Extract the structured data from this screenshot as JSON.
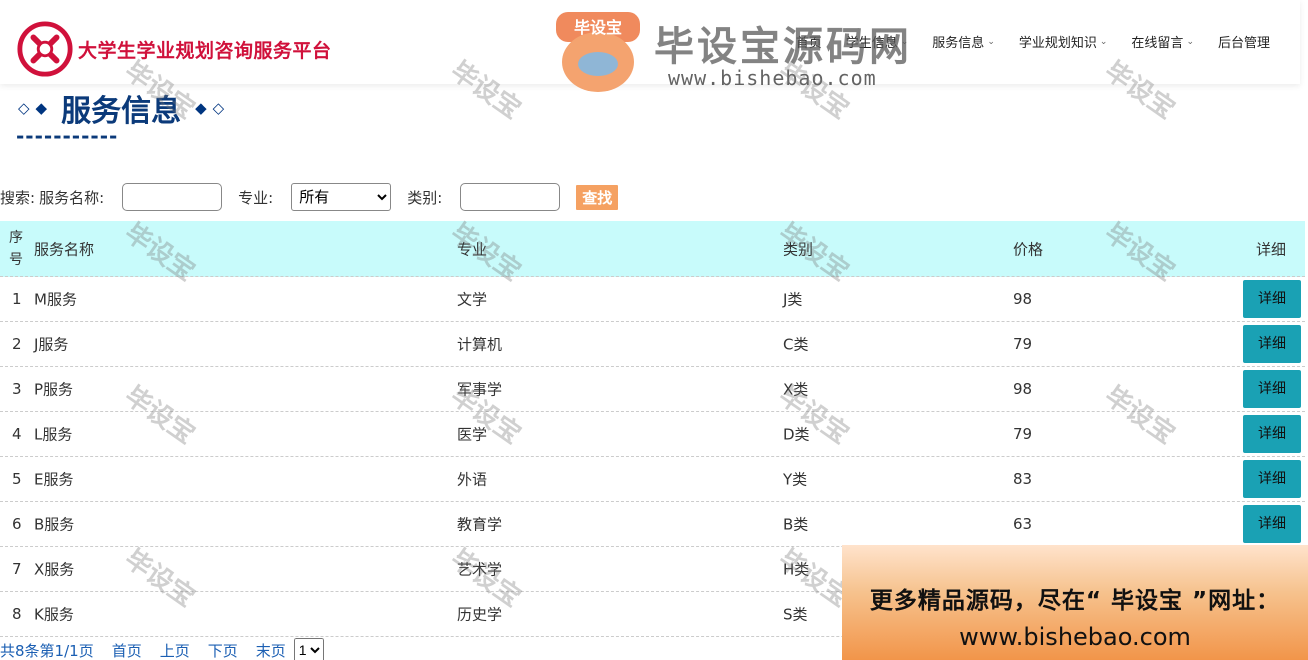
{
  "header": {
    "site_title": "大学生学业规划咨询服务平台",
    "nav": [
      {
        "label": "首页",
        "dropdown": false
      },
      {
        "label": "学生信息",
        "dropdown": true
      },
      {
        "label": "服务信息",
        "dropdown": true
      },
      {
        "label": "学业规划知识",
        "dropdown": true
      },
      {
        "label": "在线留言",
        "dropdown": true
      },
      {
        "label": "后台管理",
        "dropdown": false
      }
    ]
  },
  "section": {
    "title": "服务信息",
    "dashes": "-----------"
  },
  "search": {
    "prefix": "搜索:",
    "name_label": "服务名称:",
    "major_label": "专业:",
    "major_selected": "所有",
    "category_label": "类别:",
    "button": "查找"
  },
  "table": {
    "headers": {
      "idx": "序号",
      "name": "服务名称",
      "major": "专业",
      "category": "类别",
      "price": "价格",
      "detail": "详细"
    },
    "rows": [
      {
        "idx": "1",
        "name": "M服务",
        "major": "文学",
        "category": "J类",
        "price": "98",
        "detail": "详细"
      },
      {
        "idx": "2",
        "name": "J服务",
        "major": "计算机",
        "category": "C类",
        "price": "79",
        "detail": "详细"
      },
      {
        "idx": "3",
        "name": "P服务",
        "major": "军事学",
        "category": "X类",
        "price": "98",
        "detail": "详细"
      },
      {
        "idx": "4",
        "name": "L服务",
        "major": "医学",
        "category": "D类",
        "price": "79",
        "detail": "详细"
      },
      {
        "idx": "5",
        "name": "E服务",
        "major": "外语",
        "category": "Y类",
        "price": "83",
        "detail": "详细"
      },
      {
        "idx": "6",
        "name": "B服务",
        "major": "教育学",
        "category": "B类",
        "price": "63",
        "detail": "详细"
      },
      {
        "idx": "7",
        "name": "X服务",
        "major": "艺术学",
        "category": "H类",
        "price": "",
        "detail": ""
      },
      {
        "idx": "8",
        "name": "K服务",
        "major": "历史学",
        "category": "S类",
        "price": "",
        "detail": ""
      }
    ]
  },
  "pager": {
    "total": "共8条",
    "page": "第1/1页",
    "first": "首页",
    "prev": "上页",
    "next": "下页",
    "last": "末页",
    "page_select": "1"
  },
  "watermark": {
    "text": "毕设宝",
    "brand": "毕设宝源码网",
    "url": "www.bishebao.com",
    "mascot_label": "毕设宝"
  },
  "promo": {
    "line1": "更多精品源码，尽在“ 毕设宝 ”网址：",
    "line2": "www.bishebao.com"
  }
}
